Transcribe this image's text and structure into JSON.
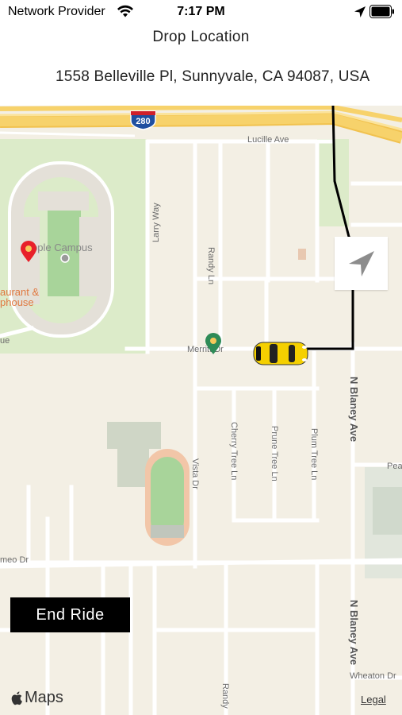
{
  "status_bar": {
    "carrier": "Network Provider",
    "time": "7:17 PM"
  },
  "header": {
    "title": "Drop Location",
    "address": "1558 Belleville Pl, Sunnyvale, CA 94087, USA"
  },
  "map": {
    "highway_shield": "280",
    "labels": {
      "lucille_ave": "Lucille Ave",
      "apple_campus": "pple Campus",
      "restaurant_1": "aurant &",
      "restaurant_2": "phouse",
      "larry_way": "Larry Way",
      "randy_ln": "Randy Ln",
      "randy_ln_bottom": "Randy",
      "merritt_dr": "Merritt Dr",
      "blaney_ave_1": "N Blaney Ave",
      "blaney_ave_2": "N Blaney Ave",
      "vista_dr": "Vista Dr",
      "cherry_tree_ln": "Cherry Tree Ln",
      "prune_tree_ln": "Prune Tree Ln",
      "plum_tree_ln": "Plum Tree Ln",
      "wheaton_dr": "Wheaton Dr",
      "meo_dr": "meo Dr",
      "ue": "ue",
      "pea": "Pea"
    },
    "colors": {
      "land": "#f3efe4",
      "park": "#d6e8c4",
      "campus_green": "#a8d49a",
      "highway": "#f7d26b",
      "route": "#000000",
      "pickup_pin": "#e8202a",
      "drop_pin": "#2e8b57",
      "car": "#f5d000"
    }
  },
  "controls": {
    "end_ride": "End Ride",
    "maps_brand": "Maps",
    "legal": "Legal"
  }
}
